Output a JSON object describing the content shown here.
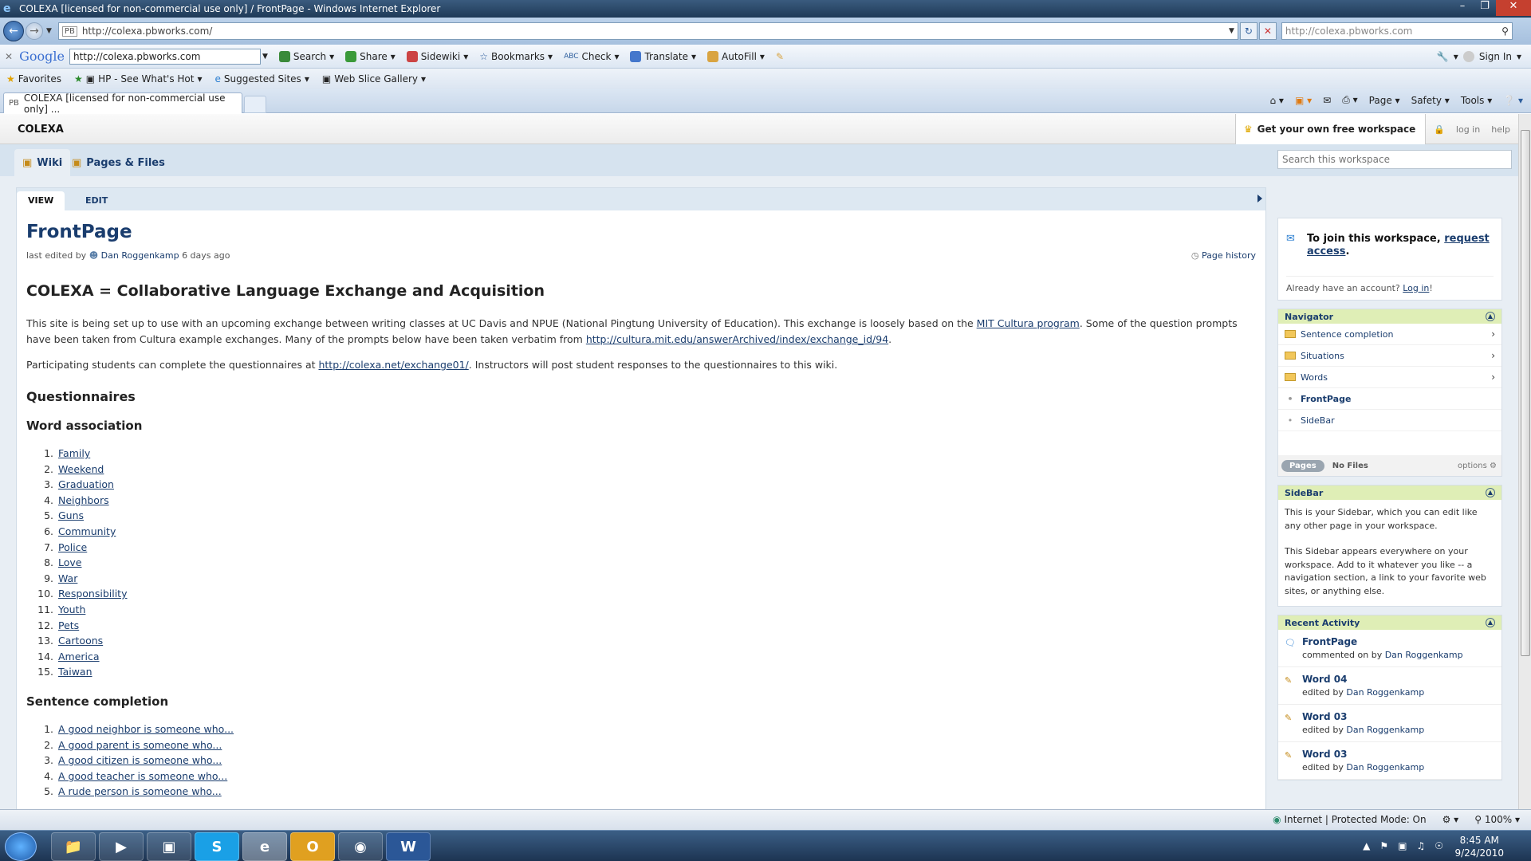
{
  "window": {
    "title": "COLEXA [licensed for non-commercial use only] / FrontPage - Windows Internet Explorer"
  },
  "address": {
    "url": "http://colexa.pbworks.com/",
    "search_url": "http://colexa.pbworks.com"
  },
  "google_toolbar": {
    "logo": "Google",
    "query": "http://colexa.pbworks.com",
    "items": [
      "Search",
      "Share",
      "Sidewiki",
      "Bookmarks",
      "Check",
      "Translate",
      "AutoFill"
    ],
    "sign_in": "Sign In"
  },
  "favorites": {
    "items": [
      "Favorites",
      "HP - See What's Hot",
      "Suggested Sites",
      "Web Slice Gallery"
    ]
  },
  "tab": {
    "label": "COLEXA [licensed for non-commercial use only] ...",
    "favicon": "PB"
  },
  "commands": [
    "Page",
    "Safety",
    "Tools"
  ],
  "pbworks": {
    "workspace": "COLEXA",
    "get_workspace": "Get your own free workspace",
    "login": "log in",
    "help": "help",
    "nav_tabs": [
      "Wiki",
      "Pages & Files"
    ],
    "search_placeholder": "Search this workspace"
  },
  "page": {
    "view_tab": "VIEW",
    "edit_tab": "EDIT",
    "title": "FrontPage",
    "meta_prefix": "last edited by",
    "editor": "Dan Roggenkamp",
    "edited_ago": "6 days ago",
    "history": "Page history",
    "heading": "COLEXA = Collaborative Language Exchange and Acquisition",
    "p1_a": "This site is being set up to use with an upcoming exchange between writing classes at UC Davis and NPUE (National Pingtung University of Education). This exchange is loosely based on the ",
    "p1_link1": "MIT Cultura program",
    "p1_b": ". Some of the question prompts have been taken from Cultura example exchanges. Many of the prompts below have been taken verbatim from ",
    "p1_link2": "http://cultura.mit.edu/answerArchived/index/exchange_id/94",
    "p1_c": ".",
    "p2_a": "Participating students can complete the questionnaires at ",
    "p2_link": "http://colexa.net/exchange01/",
    "p2_b": ". Instructors will post student responses to the questionnaires to this wiki.",
    "questionnaires": "Questionnaires",
    "word_assoc": "Word association",
    "words": [
      "Family",
      "Weekend",
      "Graduation",
      "Neighbors",
      "Guns",
      "Community",
      "Police",
      "Love",
      "War",
      "Responsibility",
      "Youth",
      "Pets",
      "Cartoons",
      "America",
      "Taiwan"
    ],
    "sentence_completion": "Sentence completion",
    "sentences": [
      "A good neighbor is someone who...",
      "A good parent is someone who...",
      "A good citizen is someone who...",
      "A good teacher is someone who...",
      "A rude person is someone who..."
    ]
  },
  "sidebar": {
    "join_a": "To join this workspace, ",
    "join_link": "request access",
    "join_b": ".",
    "account_q": "Already have an account? ",
    "account_link": "Log in",
    "account_end": "!",
    "navigator": {
      "title": "Navigator",
      "folders": [
        "Sentence completion",
        "Situations",
        "Words"
      ],
      "pages": [
        "FrontPage",
        "SideBar"
      ],
      "pages_btn": "Pages",
      "no_files": "No Files",
      "options": "options"
    },
    "sidebar_box": {
      "title": "SideBar",
      "p1": "This is your Sidebar, which you can edit like any other page in your workspace.",
      "p2": "This Sidebar appears everywhere on your workspace. Add to it whatever you like -- a navigation section, a link to your favorite web sites, or anything else."
    },
    "recent": {
      "title": "Recent Activity",
      "items": [
        {
          "title": "FrontPage",
          "action": "commented on by",
          "who": "Dan Roggenkamp"
        },
        {
          "title": "Word 04",
          "action": "edited by",
          "who": "Dan Roggenkamp"
        },
        {
          "title": "Word 03",
          "action": "edited by",
          "who": "Dan Roggenkamp"
        },
        {
          "title": "Word 03",
          "action": "edited by",
          "who": "Dan Roggenkamp"
        }
      ]
    }
  },
  "status": {
    "zone": "Internet | Protected Mode: On",
    "zoom": "100%"
  },
  "taskbar": {
    "time": "8:45 AM",
    "date": "9/24/2010"
  },
  "colors": {
    "link": "#1a3d6e",
    "box_header": "#dfeeb6",
    "nav_bg": "#d6e3ef"
  }
}
